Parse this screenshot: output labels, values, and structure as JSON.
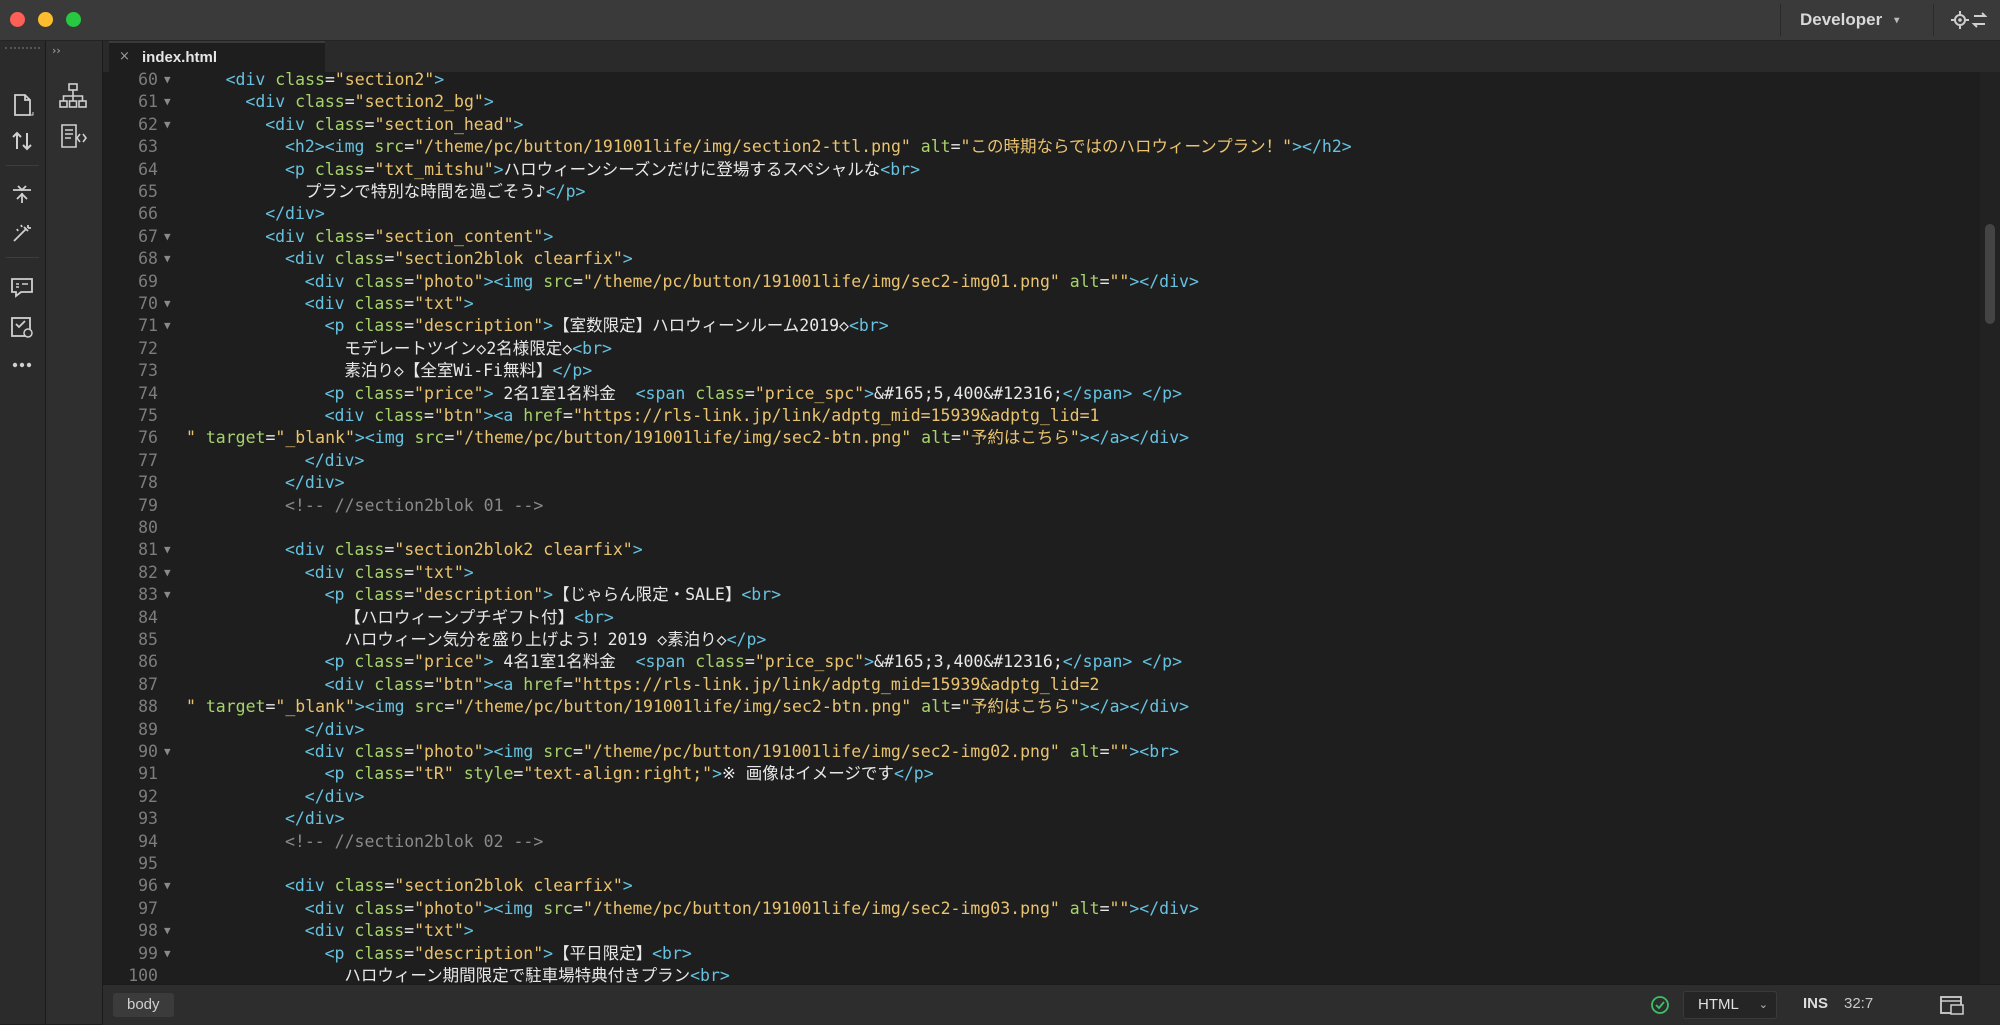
{
  "window": {
    "workspace": "Developer"
  },
  "tabs": [
    {
      "label": "index.html",
      "close": "×"
    }
  ],
  "panel": {
    "collapse": "››"
  },
  "editor": {
    "lines": [
      {
        "n": 60,
        "fold": "▼",
        "indent": 4,
        "segs": [
          [
            "tg",
            "<div "
          ],
          [
            "at",
            "class"
          ],
          [
            "tx",
            "="
          ],
          [
            "sv",
            "\"section2\""
          ],
          [
            "tg",
            ">"
          ]
        ]
      },
      {
        "n": 61,
        "fold": "▼",
        "indent": 6,
        "segs": [
          [
            "tg",
            "<div "
          ],
          [
            "at",
            "class"
          ],
          [
            "tx",
            "="
          ],
          [
            "sv",
            "\"section2_bg\""
          ],
          [
            "tg",
            ">"
          ]
        ]
      },
      {
        "n": 62,
        "fold": "▼",
        "indent": 8,
        "segs": [
          [
            "tg",
            "<div "
          ],
          [
            "at",
            "class"
          ],
          [
            "tx",
            "="
          ],
          [
            "sv",
            "\"section_head\""
          ],
          [
            "tg",
            ">"
          ]
        ]
      },
      {
        "n": 63,
        "fold": "",
        "indent": 10,
        "segs": [
          [
            "tg",
            "<h2><img "
          ],
          [
            "at",
            "src"
          ],
          [
            "tx",
            "="
          ],
          [
            "sv",
            "\"/theme/pc/button/191001life/img/section2-ttl.png\""
          ],
          [
            "tx",
            " "
          ],
          [
            "at",
            "alt"
          ],
          [
            "tx",
            "="
          ],
          [
            "sv",
            "\"この時期ならではのハロウィーンプラン！\""
          ],
          [
            "tg",
            "></h2>"
          ]
        ]
      },
      {
        "n": 64,
        "fold": "",
        "indent": 10,
        "segs": [
          [
            "tg",
            "<p "
          ],
          [
            "at",
            "class"
          ],
          [
            "tx",
            "="
          ],
          [
            "sv",
            "\"txt_mitshu\""
          ],
          [
            "tg",
            ">"
          ],
          [
            "tx",
            "ハロウィーンシーズンだけに登場するスペシャルな"
          ],
          [
            "tg",
            "<br>"
          ]
        ]
      },
      {
        "n": 65,
        "fold": "",
        "indent": 12,
        "segs": [
          [
            "tx",
            "プランで特別な時間を過ごそう♪"
          ],
          [
            "tg",
            "</p>"
          ]
        ]
      },
      {
        "n": 66,
        "fold": "",
        "indent": 8,
        "segs": [
          [
            "tg",
            "</div>"
          ]
        ]
      },
      {
        "n": 67,
        "fold": "▼",
        "indent": 8,
        "segs": [
          [
            "tg",
            "<div "
          ],
          [
            "at",
            "class"
          ],
          [
            "tx",
            "="
          ],
          [
            "sv",
            "\"section_content\""
          ],
          [
            "tg",
            ">"
          ]
        ]
      },
      {
        "n": 68,
        "fold": "▼",
        "indent": 10,
        "segs": [
          [
            "tg",
            "<div "
          ],
          [
            "at",
            "class"
          ],
          [
            "tx",
            "="
          ],
          [
            "sv",
            "\"section2blok clearfix\""
          ],
          [
            "tg",
            ">"
          ]
        ]
      },
      {
        "n": 69,
        "fold": "",
        "indent": 12,
        "segs": [
          [
            "tg",
            "<div "
          ],
          [
            "at",
            "class"
          ],
          [
            "tx",
            "="
          ],
          [
            "sv",
            "\"photo\""
          ],
          [
            "tg",
            "><img "
          ],
          [
            "at",
            "src"
          ],
          [
            "tx",
            "="
          ],
          [
            "sv",
            "\"/theme/pc/button/191001life/img/sec2-img01.png\""
          ],
          [
            "tx",
            " "
          ],
          [
            "at",
            "alt"
          ],
          [
            "tx",
            "="
          ],
          [
            "sv",
            "\"\""
          ],
          [
            "tg",
            "></div>"
          ]
        ]
      },
      {
        "n": 70,
        "fold": "▼",
        "indent": 12,
        "segs": [
          [
            "tg",
            "<div "
          ],
          [
            "at",
            "class"
          ],
          [
            "tx",
            "="
          ],
          [
            "sv",
            "\"txt\""
          ],
          [
            "tg",
            ">"
          ]
        ]
      },
      {
        "n": 71,
        "fold": "▼",
        "indent": 14,
        "segs": [
          [
            "tg",
            "<p "
          ],
          [
            "at",
            "class"
          ],
          [
            "tx",
            "="
          ],
          [
            "sv",
            "\"description\""
          ],
          [
            "tg",
            ">"
          ],
          [
            "tx",
            "【室数限定】ハロウィーンルーム2019◇"
          ],
          [
            "tg",
            "<br>"
          ]
        ]
      },
      {
        "n": 72,
        "fold": "",
        "indent": 16,
        "segs": [
          [
            "tx",
            "モデレートツイン◇2名様限定◇"
          ],
          [
            "tg",
            "<br>"
          ]
        ]
      },
      {
        "n": 73,
        "fold": "",
        "indent": 16,
        "segs": [
          [
            "tx",
            "素泊り◇【全室Wi-Fi無料】"
          ],
          [
            "tg",
            "</p>"
          ]
        ]
      },
      {
        "n": 74,
        "fold": "",
        "indent": 14,
        "segs": [
          [
            "tg",
            "<p "
          ],
          [
            "at",
            "class"
          ],
          [
            "tx",
            "="
          ],
          [
            "sv",
            "\"price\""
          ],
          [
            "tg",
            ">"
          ],
          [
            "tx",
            " 2名1室1名料金  "
          ],
          [
            "tg",
            "<span "
          ],
          [
            "at",
            "class"
          ],
          [
            "tx",
            "="
          ],
          [
            "sv",
            "\"price_spc\""
          ],
          [
            "tg",
            ">"
          ],
          [
            "tx",
            "&#165;5,400&#12316;"
          ],
          [
            "tg",
            "</span>"
          ],
          [
            "tx",
            " "
          ],
          [
            "tg",
            "</p>"
          ]
        ]
      },
      {
        "n": 75,
        "fold": "",
        "indent": 14,
        "segs": [
          [
            "tg",
            "<div "
          ],
          [
            "at",
            "class"
          ],
          [
            "tx",
            "="
          ],
          [
            "sv",
            "\"btn\""
          ],
          [
            "tg",
            "><a "
          ],
          [
            "at",
            "href"
          ],
          [
            "tx",
            "="
          ],
          [
            "sv",
            "\"https://rls-link.jp/link/adptg_mid=15939&adptg_lid=1"
          ]
        ]
      },
      {
        "n": 76,
        "fold": "",
        "indent": 0,
        "segs": [
          [
            "sv",
            "\""
          ],
          [
            "tx",
            " "
          ],
          [
            "at",
            "target"
          ],
          [
            "tx",
            "="
          ],
          [
            "sv",
            "\"_blank\""
          ],
          [
            "tg",
            "><img "
          ],
          [
            "at",
            "src"
          ],
          [
            "tx",
            "="
          ],
          [
            "sv",
            "\"/theme/pc/button/191001life/img/sec2-btn.png\""
          ],
          [
            "tx",
            " "
          ],
          [
            "at",
            "alt"
          ],
          [
            "tx",
            "="
          ],
          [
            "sv",
            "\"予約はこちら\""
          ],
          [
            "tg",
            "></a></div>"
          ]
        ]
      },
      {
        "n": 77,
        "fold": "",
        "indent": 12,
        "segs": [
          [
            "tg",
            "</div>"
          ]
        ]
      },
      {
        "n": 78,
        "fold": "",
        "indent": 10,
        "segs": [
          [
            "tg",
            "</div>"
          ]
        ]
      },
      {
        "n": 79,
        "fold": "",
        "indent": 10,
        "segs": [
          [
            "cm",
            "<!-- //section2blok 01 -->"
          ]
        ]
      },
      {
        "n": 80,
        "fold": "",
        "indent": 0,
        "segs": []
      },
      {
        "n": 81,
        "fold": "▼",
        "indent": 10,
        "segs": [
          [
            "tg",
            "<div "
          ],
          [
            "at",
            "class"
          ],
          [
            "tx",
            "="
          ],
          [
            "sv",
            "\"section2blok2 clearfix\""
          ],
          [
            "tg",
            ">"
          ]
        ]
      },
      {
        "n": 82,
        "fold": "▼",
        "indent": 12,
        "segs": [
          [
            "tg",
            "<div "
          ],
          [
            "at",
            "class"
          ],
          [
            "tx",
            "="
          ],
          [
            "sv",
            "\"txt\""
          ],
          [
            "tg",
            ">"
          ]
        ]
      },
      {
        "n": 83,
        "fold": "▼",
        "indent": 14,
        "segs": [
          [
            "tg",
            "<p "
          ],
          [
            "at",
            "class"
          ],
          [
            "tx",
            "="
          ],
          [
            "sv",
            "\"description\""
          ],
          [
            "tg",
            ">"
          ],
          [
            "tx",
            "【じゃらん限定・SALE】"
          ],
          [
            "tg",
            "<br>"
          ]
        ]
      },
      {
        "n": 84,
        "fold": "",
        "indent": 16,
        "segs": [
          [
            "tx",
            "【ハロウィーンプチギフト付】"
          ],
          [
            "tg",
            "<br>"
          ]
        ]
      },
      {
        "n": 85,
        "fold": "",
        "indent": 16,
        "segs": [
          [
            "tx",
            "ハロウィーン気分を盛り上げよう！2019 ◇素泊り◇"
          ],
          [
            "tg",
            "</p>"
          ]
        ]
      },
      {
        "n": 86,
        "fold": "",
        "indent": 14,
        "segs": [
          [
            "tg",
            "<p "
          ],
          [
            "at",
            "class"
          ],
          [
            "tx",
            "="
          ],
          [
            "sv",
            "\"price\""
          ],
          [
            "tg",
            ">"
          ],
          [
            "tx",
            " 4名1室1名料金  "
          ],
          [
            "tg",
            "<span "
          ],
          [
            "at",
            "class"
          ],
          [
            "tx",
            "="
          ],
          [
            "sv",
            "\"price_spc\""
          ],
          [
            "tg",
            ">"
          ],
          [
            "tx",
            "&#165;3,400&#12316;"
          ],
          [
            "tg",
            "</span>"
          ],
          [
            "tx",
            " "
          ],
          [
            "tg",
            "</p>"
          ]
        ]
      },
      {
        "n": 87,
        "fold": "",
        "indent": 14,
        "segs": [
          [
            "tg",
            "<div "
          ],
          [
            "at",
            "class"
          ],
          [
            "tx",
            "="
          ],
          [
            "sv",
            "\"btn\""
          ],
          [
            "tg",
            "><a "
          ],
          [
            "at",
            "href"
          ],
          [
            "tx",
            "="
          ],
          [
            "sv",
            "\"https://rls-link.jp/link/adptg_mid=15939&adptg_lid=2"
          ]
        ]
      },
      {
        "n": 88,
        "fold": "",
        "indent": 0,
        "segs": [
          [
            "sv",
            "\""
          ],
          [
            "tx",
            " "
          ],
          [
            "at",
            "target"
          ],
          [
            "tx",
            "="
          ],
          [
            "sv",
            "\"_blank\""
          ],
          [
            "tg",
            "><img "
          ],
          [
            "at",
            "src"
          ],
          [
            "tx",
            "="
          ],
          [
            "sv",
            "\"/theme/pc/button/191001life/img/sec2-btn.png\""
          ],
          [
            "tx",
            " "
          ],
          [
            "at",
            "alt"
          ],
          [
            "tx",
            "="
          ],
          [
            "sv",
            "\"予約はこちら\""
          ],
          [
            "tg",
            "></a></div>"
          ]
        ]
      },
      {
        "n": 89,
        "fold": "",
        "indent": 12,
        "segs": [
          [
            "tg",
            "</div>"
          ]
        ]
      },
      {
        "n": 90,
        "fold": "▼",
        "indent": 12,
        "segs": [
          [
            "tg",
            "<div "
          ],
          [
            "at",
            "class"
          ],
          [
            "tx",
            "="
          ],
          [
            "sv",
            "\"photo\""
          ],
          [
            "tg",
            "><img "
          ],
          [
            "at",
            "src"
          ],
          [
            "tx",
            "="
          ],
          [
            "sv",
            "\"/theme/pc/button/191001life/img/sec2-img02.png\""
          ],
          [
            "tx",
            " "
          ],
          [
            "at",
            "alt"
          ],
          [
            "tx",
            "="
          ],
          [
            "sv",
            "\"\""
          ],
          [
            "tg",
            "><br>"
          ]
        ]
      },
      {
        "n": 91,
        "fold": "",
        "indent": 14,
        "segs": [
          [
            "tg",
            "<p "
          ],
          [
            "at",
            "class"
          ],
          [
            "tx",
            "="
          ],
          [
            "sv",
            "\"tR\""
          ],
          [
            "tx",
            " "
          ],
          [
            "at",
            "style"
          ],
          [
            "tx",
            "="
          ],
          [
            "sv",
            "\"text-align:right;\""
          ],
          [
            "tg",
            ">"
          ],
          [
            "tx",
            "※ 画像はイメージです"
          ],
          [
            "tg",
            "</p>"
          ]
        ]
      },
      {
        "n": 92,
        "fold": "",
        "indent": 12,
        "segs": [
          [
            "tg",
            "</div>"
          ]
        ]
      },
      {
        "n": 93,
        "fold": "",
        "indent": 10,
        "segs": [
          [
            "tg",
            "</div>"
          ]
        ]
      },
      {
        "n": 94,
        "fold": "",
        "indent": 10,
        "segs": [
          [
            "cm",
            "<!-- //section2blok 02 -->"
          ]
        ]
      },
      {
        "n": 95,
        "fold": "",
        "indent": 0,
        "segs": []
      },
      {
        "n": 96,
        "fold": "▼",
        "indent": 10,
        "segs": [
          [
            "tg",
            "<div "
          ],
          [
            "at",
            "class"
          ],
          [
            "tx",
            "="
          ],
          [
            "sv",
            "\"section2blok clearfix\""
          ],
          [
            "tg",
            ">"
          ]
        ]
      },
      {
        "n": 97,
        "fold": "",
        "indent": 12,
        "segs": [
          [
            "tg",
            "<div "
          ],
          [
            "at",
            "class"
          ],
          [
            "tx",
            "="
          ],
          [
            "sv",
            "\"photo\""
          ],
          [
            "tg",
            "><img "
          ],
          [
            "at",
            "src"
          ],
          [
            "tx",
            "="
          ],
          [
            "sv",
            "\"/theme/pc/button/191001life/img/sec2-img03.png\""
          ],
          [
            "tx",
            " "
          ],
          [
            "at",
            "alt"
          ],
          [
            "tx",
            "="
          ],
          [
            "sv",
            "\"\""
          ],
          [
            "tg",
            "></div>"
          ]
        ]
      },
      {
        "n": 98,
        "fold": "▼",
        "indent": 12,
        "segs": [
          [
            "tg",
            "<div "
          ],
          [
            "at",
            "class"
          ],
          [
            "tx",
            "="
          ],
          [
            "sv",
            "\"txt\""
          ],
          [
            "tg",
            ">"
          ]
        ]
      },
      {
        "n": 99,
        "fold": "▼",
        "indent": 14,
        "segs": [
          [
            "tg",
            "<p "
          ],
          [
            "at",
            "class"
          ],
          [
            "tx",
            "="
          ],
          [
            "sv",
            "\"description\""
          ],
          [
            "tg",
            ">"
          ],
          [
            "tx",
            "【平日限定】"
          ],
          [
            "tg",
            "<br>"
          ]
        ]
      },
      {
        "n": 100,
        "fold": "",
        "indent": 16,
        "segs": [
          [
            "tx",
            "ハロウィーン期間限定で駐車場特典付きプラン"
          ],
          [
            "tg",
            "<br>"
          ]
        ]
      }
    ]
  },
  "statusbar": {
    "tag": "body",
    "language": "HTML",
    "mode": "INS",
    "position": "32:7"
  },
  "colors": {
    "tag": "#66c2e0",
    "attribute": "#a6d36b",
    "string": "#eac36f",
    "comment": "#8a8a8a",
    "background": "#1e1e1e"
  },
  "icons": {
    "toolstrip": [
      "file-icon",
      "sort-icon",
      "split-icon",
      "wand-icon",
      "comment-icon",
      "validate-icon",
      "more-icon"
    ],
    "panelstrip": [
      "dom-tree-icon",
      "code-navigator-icon"
    ]
  }
}
